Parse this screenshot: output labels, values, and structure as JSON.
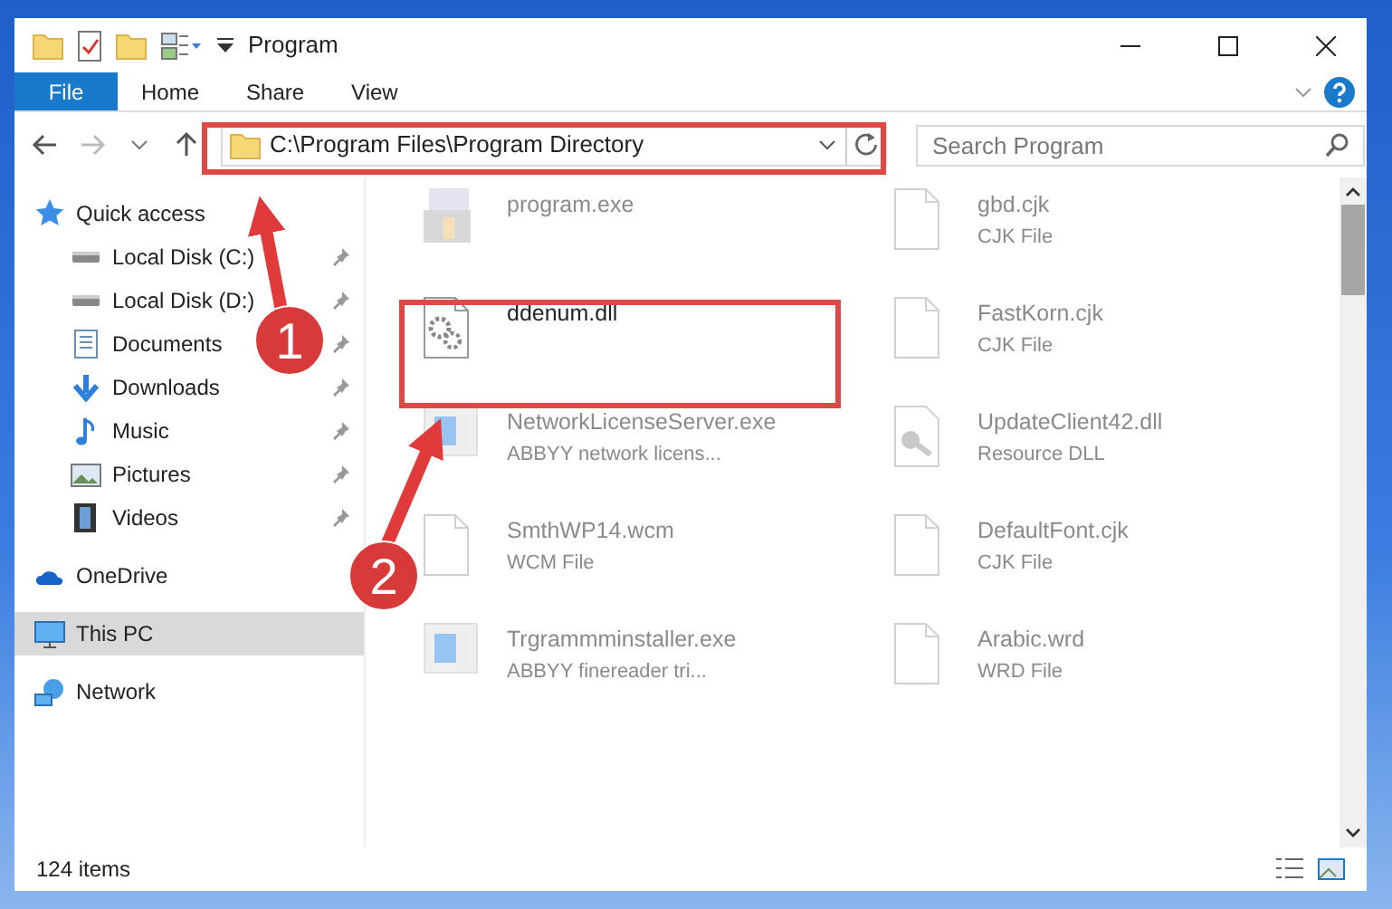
{
  "window": {
    "title": "Program"
  },
  "ribbon_tabs": [
    {
      "label": "File",
      "selected": true
    },
    {
      "label": "Home",
      "selected": false
    },
    {
      "label": "Share",
      "selected": false
    },
    {
      "label": "View",
      "selected": false
    }
  ],
  "address": {
    "path": "C:\\Program Files\\Program Directory"
  },
  "search": {
    "placeholder": "Search Program"
  },
  "sidebar": {
    "items": [
      {
        "label": "Quick access",
        "kind": "star",
        "pinned": false,
        "selected": false,
        "children": [
          {
            "label": "Local Disk (C:)",
            "kind": "drive",
            "pinned": true,
            "selected": false
          },
          {
            "label": "Local Disk (D:)",
            "kind": "drive",
            "pinned": true,
            "selected": false
          },
          {
            "label": "Documents",
            "kind": "documents",
            "pinned": true,
            "selected": false
          },
          {
            "label": "Downloads",
            "kind": "downloads",
            "pinned": true,
            "selected": false
          },
          {
            "label": "Music",
            "kind": "music",
            "pinned": true,
            "selected": false
          },
          {
            "label": "Pictures",
            "kind": "pictures",
            "pinned": true,
            "selected": false
          },
          {
            "label": "Videos",
            "kind": "videos",
            "pinned": true,
            "selected": false
          }
        ]
      },
      {
        "label": "OneDrive",
        "kind": "cloud",
        "pinned": false,
        "selected": false
      },
      {
        "label": "This PC",
        "kind": "pc",
        "pinned": false,
        "selected": true
      },
      {
        "label": "Network",
        "kind": "network",
        "pinned": false,
        "selected": false
      }
    ]
  },
  "files": [
    {
      "name": "program.exe",
      "kind": "exe",
      "focus": false
    },
    {
      "name": "gbd.cjk",
      "type": "CJK File",
      "kind": "blank",
      "focus": false
    },
    {
      "name": "ddenum.dll",
      "kind": "dll",
      "focus": true
    },
    {
      "name": "FastKorn.cjk",
      "type": "CJK File",
      "kind": "blank",
      "focus": false
    },
    {
      "name": "NetworkLicenseServer.exe",
      "type": "ABBYY network licens...",
      "kind": "app",
      "focus": false
    },
    {
      "name": "UpdateClient42.dll",
      "type": "Resource DLL",
      "kind": "resource",
      "focus": false
    },
    {
      "name": "SmthWP14.wcm",
      "type": "WCM File",
      "kind": "blank",
      "focus": false
    },
    {
      "name": "DefaultFont.cjk",
      "type": "CJK File",
      "kind": "blank",
      "focus": false
    },
    {
      "name": "Trgrammminstaller.exe",
      "type": "ABBYY finereader tri...",
      "kind": "app",
      "focus": false
    },
    {
      "name": "Arabic.wrd",
      "type": "WRD File",
      "kind": "blank",
      "focus": false
    }
  ],
  "status_bar": {
    "count": "124 items"
  },
  "annotations": [
    {
      "label": "1"
    },
    {
      "label": "2"
    }
  ]
}
